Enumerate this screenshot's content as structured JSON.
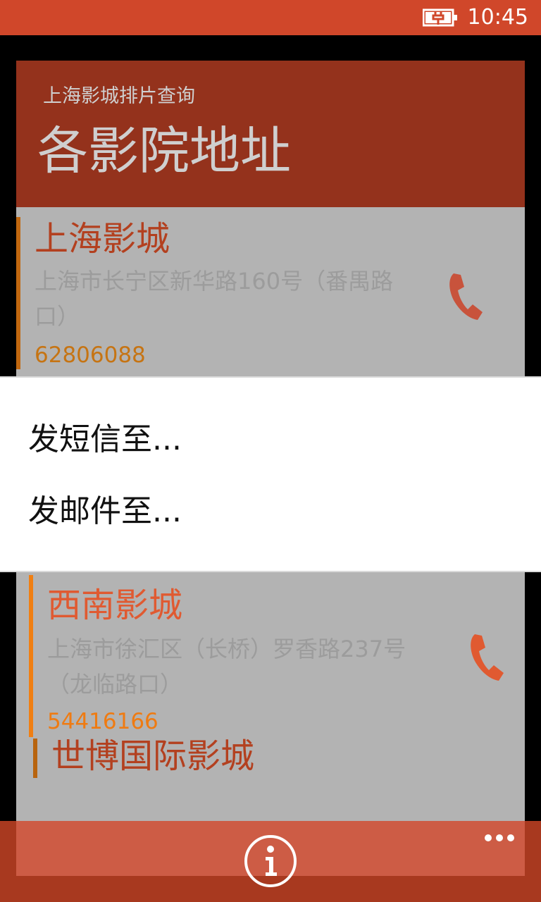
{
  "status_bar": {
    "time": "10:45",
    "battery_icon": "battery-charging-icon"
  },
  "header": {
    "app_name": "上海影城排片查询",
    "page_title": "各影院地址"
  },
  "cinemas": [
    {
      "name": "上海影城",
      "address": "上海市长宁区新华路160号（番禺路口）",
      "phone": "62806088",
      "call_icon": "phone-icon"
    },
    {
      "name": "西南影城",
      "address": "上海市徐汇区（长桥）罗香路237号（龙临路口）",
      "phone": "54416166",
      "call_icon": "phone-icon"
    },
    {
      "name": "世博国际影城"
    }
  ],
  "context_menu": {
    "items": [
      {
        "label": "发短信至..."
      },
      {
        "label": "发邮件至..."
      }
    ]
  },
  "app_bar": {
    "info_icon": "info-icon",
    "more_icon": "more-icon"
  },
  "colors": {
    "status_bar": "#d0472a",
    "header_bg": "#94321c",
    "cinema_name_active": "#e05a31",
    "cinema_name": "#b3401f",
    "phone_text": "#c67413",
    "phone_icon": "#e05a31",
    "app_bar": "#cd5c45"
  }
}
